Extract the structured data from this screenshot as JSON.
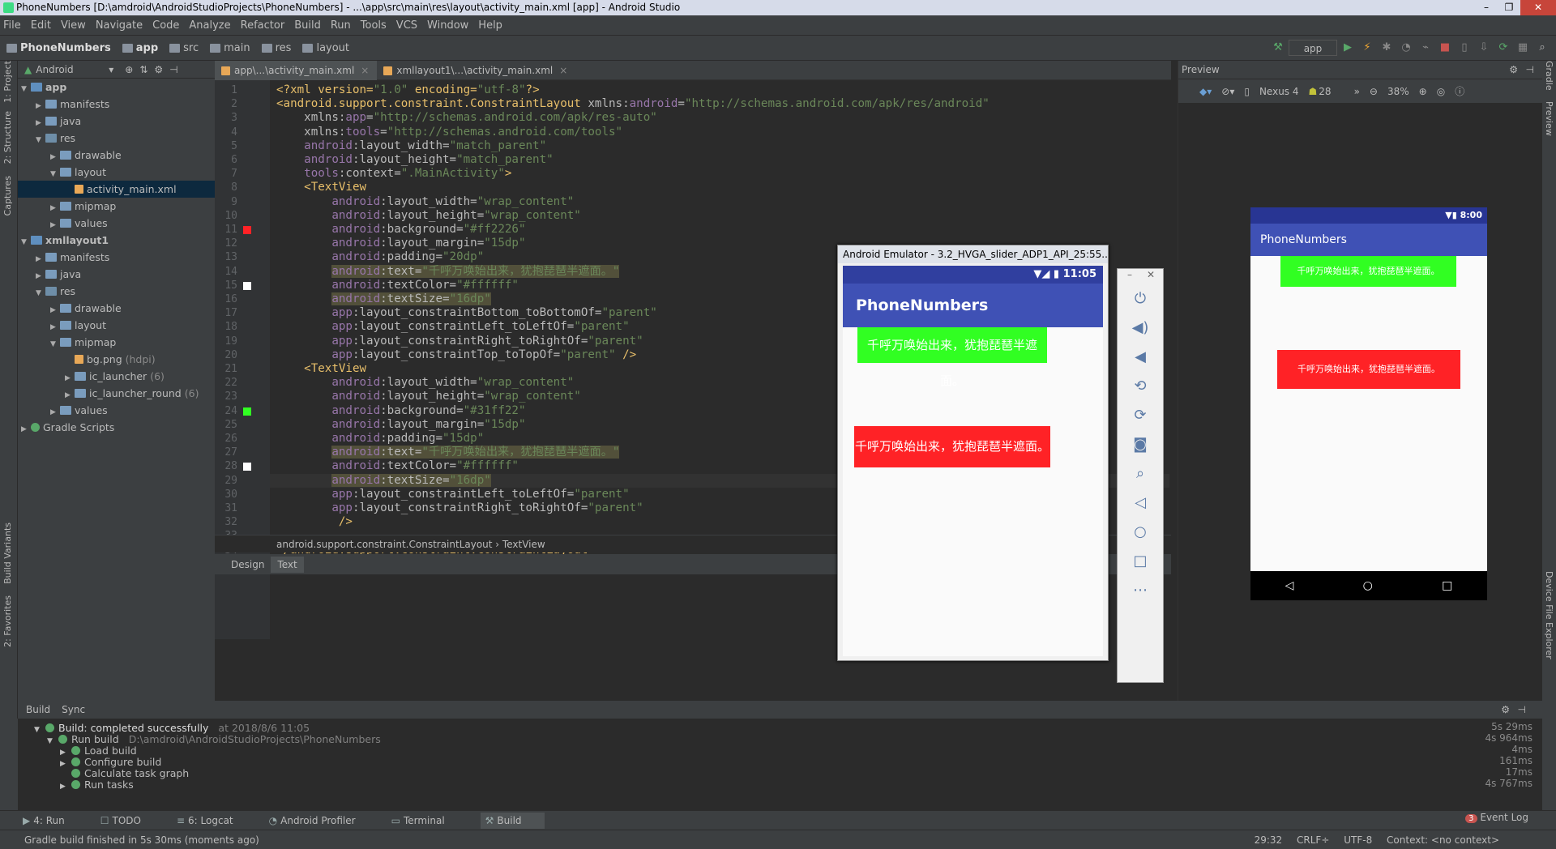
{
  "window": {
    "title": "PhoneNumbers [D:\\amdroid\\AndroidStudioProjects\\PhoneNumbers] - ...\\app\\src\\main\\res\\layout\\activity_main.xml [app] - Android Studio"
  },
  "menu": [
    "File",
    "Edit",
    "View",
    "Navigate",
    "Code",
    "Analyze",
    "Refactor",
    "Build",
    "Run",
    "Tools",
    "VCS",
    "Window",
    "Help"
  ],
  "breadcrumb": [
    "PhoneNumbers",
    "app",
    "src",
    "main",
    "res",
    "layout"
  ],
  "toolbar": {
    "config": "app"
  },
  "left_tabs": [
    "1: Project",
    "2: Structure",
    "Captures",
    "Build Variants",
    "2: Favorites"
  ],
  "project": {
    "view": "Android",
    "tree": [
      {
        "label": "app",
        "indent": 0,
        "arrow": "▼",
        "icon": "mod",
        "bold": true
      },
      {
        "label": "manifests",
        "indent": 1,
        "arrow": "▶",
        "icon": "fold"
      },
      {
        "label": "java",
        "indent": 1,
        "arrow": "▶",
        "icon": "fold"
      },
      {
        "label": "res",
        "indent": 1,
        "arrow": "▼",
        "icon": "res"
      },
      {
        "label": "drawable",
        "indent": 2,
        "arrow": "▶",
        "icon": "fold"
      },
      {
        "label": "layout",
        "indent": 2,
        "arrow": "▼",
        "icon": "fold"
      },
      {
        "label": "activity_main.xml",
        "indent": 3,
        "arrow": "",
        "icon": "file",
        "selected": true
      },
      {
        "label": "mipmap",
        "indent": 2,
        "arrow": "▶",
        "icon": "fold"
      },
      {
        "label": "values",
        "indent": 2,
        "arrow": "▶",
        "icon": "fold"
      },
      {
        "label": "xmllayout1",
        "indent": 0,
        "arrow": "▼",
        "icon": "mod",
        "bold": true
      },
      {
        "label": "manifests",
        "indent": 1,
        "arrow": "▶",
        "icon": "fold"
      },
      {
        "label": "java",
        "indent": 1,
        "arrow": "▶",
        "icon": "fold"
      },
      {
        "label": "res",
        "indent": 1,
        "arrow": "▼",
        "icon": "res"
      },
      {
        "label": "drawable",
        "indent": 2,
        "arrow": "▶",
        "icon": "fold"
      },
      {
        "label": "layout",
        "indent": 2,
        "arrow": "▶",
        "icon": "fold"
      },
      {
        "label": "mipmap",
        "indent": 2,
        "arrow": "▼",
        "icon": "fold"
      },
      {
        "label": "bg.png",
        "count": "(hdpi)",
        "indent": 3,
        "arrow": "",
        "icon": "file"
      },
      {
        "label": "ic_launcher",
        "count": "(6)",
        "indent": 3,
        "arrow": "▶",
        "icon": "fold"
      },
      {
        "label": "ic_launcher_round",
        "count": "(6)",
        "indent": 3,
        "arrow": "▶",
        "icon": "fold"
      },
      {
        "label": "values",
        "indent": 2,
        "arrow": "▶",
        "icon": "fold"
      },
      {
        "label": "Gradle Scripts",
        "indent": 0,
        "arrow": "▶",
        "icon": "grad"
      }
    ]
  },
  "editor": {
    "tabs": [
      {
        "label": "app\\...\\activity_main.xml",
        "active": true
      },
      {
        "label": "xmllayout1\\...\\activity_main.xml",
        "active": false
      }
    ],
    "gutter_colors": {
      "11": "#ff2226",
      "15": "#ffffff",
      "24": "#31ff22",
      "28": "#ffffff"
    },
    "current_line": 29,
    "lines": [
      [
        [
          "pi",
          "<?xml version="
        ],
        [
          "sv",
          "\"1.0\""
        ],
        [
          "pi",
          " encoding="
        ],
        [
          "sv",
          "\"utf-8\""
        ],
        [
          "pi",
          "?>"
        ]
      ],
      [
        [
          "tg",
          "<android.support.constraint.ConstraintLayout "
        ],
        [
          "at",
          "xmlns:"
        ],
        [
          "ns",
          "android"
        ],
        [
          "at",
          "="
        ],
        [
          "sv",
          "\"http://schemas.android.com/apk/res/android\""
        ]
      ],
      [
        [
          "at",
          "    xmlns:"
        ],
        [
          "ns",
          "app"
        ],
        [
          "at",
          "="
        ],
        [
          "sv",
          "\"http://schemas.android.com/apk/res-auto\""
        ]
      ],
      [
        [
          "at",
          "    xmlns:"
        ],
        [
          "ns",
          "tools"
        ],
        [
          "at",
          "="
        ],
        [
          "sv",
          "\"http://schemas.android.com/tools\""
        ]
      ],
      [
        [
          "ns",
          "    android"
        ],
        [
          "at",
          ":layout_width="
        ],
        [
          "sv",
          "\"match_parent\""
        ]
      ],
      [
        [
          "ns",
          "    android"
        ],
        [
          "at",
          ":layout_height="
        ],
        [
          "sv",
          "\"match_parent\""
        ]
      ],
      [
        [
          "ns",
          "    tools"
        ],
        [
          "at",
          ":context="
        ],
        [
          "sv",
          "\".MainActivity\""
        ],
        [
          "tg",
          ">"
        ]
      ],
      [
        [
          "tg",
          "    <TextView"
        ]
      ],
      [
        [
          "ns",
          "        android"
        ],
        [
          "at",
          ":layout_width="
        ],
        [
          "sv",
          "\"wrap_content\""
        ]
      ],
      [
        [
          "ns",
          "        android"
        ],
        [
          "at",
          ":layout_height="
        ],
        [
          "sv",
          "\"wrap_content\""
        ]
      ],
      [
        [
          "ns",
          "        android"
        ],
        [
          "at",
          ":background="
        ],
        [
          "sv",
          "\"#ff2226\""
        ]
      ],
      [
        [
          "ns",
          "        android"
        ],
        [
          "at",
          ":layout_margin="
        ],
        [
          "sv",
          "\"15dp\""
        ]
      ],
      [
        [
          "ns",
          "        android"
        ],
        [
          "at",
          ":padding="
        ],
        [
          "sv",
          "\"20dp\""
        ]
      ],
      [
        [
          "ns",
          "        "
        ],
        [
          "ns hl",
          "android"
        ],
        [
          "at hl",
          ":text="
        ],
        [
          "sv hl",
          "\"千呼万唤始出来，犹抱琵琶半遮面。\""
        ]
      ],
      [
        [
          "ns",
          "        android"
        ],
        [
          "at",
          ":textColor="
        ],
        [
          "sv",
          "\"#ffffff\""
        ]
      ],
      [
        [
          "ns",
          "        "
        ],
        [
          "ns hl",
          "android"
        ],
        [
          "at hl",
          ":textSize="
        ],
        [
          "sv hl",
          "\"16dp\""
        ]
      ],
      [
        [
          "ns",
          "        app"
        ],
        [
          "at",
          ":layout_constraintBottom_toBottomOf="
        ],
        [
          "sv",
          "\"parent\""
        ]
      ],
      [
        [
          "ns",
          "        app"
        ],
        [
          "at",
          ":layout_constraintLeft_toLeftOf="
        ],
        [
          "sv",
          "\"parent\""
        ]
      ],
      [
        [
          "ns",
          "        app"
        ],
        [
          "at",
          ":layout_constraintRight_toRightOf="
        ],
        [
          "sv",
          "\"parent\""
        ]
      ],
      [
        [
          "ns",
          "        app"
        ],
        [
          "at",
          ":layout_constraintTop_toTopOf="
        ],
        [
          "sv",
          "\"parent\""
        ],
        [
          "tg",
          " />"
        ]
      ],
      [
        [
          "tg",
          "    <TextView"
        ]
      ],
      [
        [
          "ns",
          "        android"
        ],
        [
          "at",
          ":layout_width="
        ],
        [
          "sv",
          "\"wrap_content\""
        ]
      ],
      [
        [
          "ns",
          "        android"
        ],
        [
          "at",
          ":layout_height="
        ],
        [
          "sv",
          "\"wrap_content\""
        ]
      ],
      [
        [
          "ns",
          "        android"
        ],
        [
          "at",
          ":background="
        ],
        [
          "sv",
          "\"#31ff22\""
        ]
      ],
      [
        [
          "ns",
          "        android"
        ],
        [
          "at",
          ":layout_margin="
        ],
        [
          "sv",
          "\"15dp\""
        ]
      ],
      [
        [
          "ns",
          "        android"
        ],
        [
          "at",
          ":padding="
        ],
        [
          "sv",
          "\"15dp\""
        ]
      ],
      [
        [
          "ns",
          "        "
        ],
        [
          "ns hl",
          "android"
        ],
        [
          "at hl",
          ":text="
        ],
        [
          "sv hl",
          "\"千呼万唤始出来，犹抱琵琶半遮面。\""
        ]
      ],
      [
        [
          "ns",
          "        android"
        ],
        [
          "at",
          ":textColor="
        ],
        [
          "sv",
          "\"#ffffff\""
        ]
      ],
      [
        [
          "ns",
          "        "
        ],
        [
          "ns hl",
          "android"
        ],
        [
          "at hl",
          ":textSize="
        ],
        [
          "sv hl",
          "\"16dp\""
        ]
      ],
      [
        [
          "ns",
          "        app"
        ],
        [
          "at",
          ":layout_constraintLeft_toLeftOf="
        ],
        [
          "sv",
          "\"parent\""
        ]
      ],
      [
        [
          "ns",
          "        app"
        ],
        [
          "at",
          ":layout_constraintRight_toRightOf="
        ],
        [
          "sv",
          "\"parent\""
        ]
      ],
      [
        [
          "tg",
          "         />"
        ]
      ],
      [
        [
          "at",
          ""
        ]
      ],
      [
        [
          "tg",
          "</android.support.constraint.ConstraintLayout>"
        ]
      ]
    ],
    "crumbs": "android.support.constraint.ConstraintLayout  ›  TextView",
    "design_tab": "Design",
    "text_tab": "Text"
  },
  "preview": {
    "title": "Preview",
    "device": "Nexus 4",
    "api": "28",
    "zoom": "38%",
    "time": "8:00",
    "app_title": "PhoneNumbers",
    "text": "千呼万唤始出来，犹抱琵琶半遮面。",
    "green": "#31ff22",
    "red": "#ff2226"
  },
  "emulator": {
    "title": "Android Emulator - 3.2_HVGA_slider_ADP1_API_25:55...",
    "time": "11:05",
    "app_title": "PhoneNumbers",
    "text": "千呼万唤始出来，犹抱琵琶半遮面。",
    "controls": [
      "power-icon",
      "volume-up-icon",
      "volume-down-icon",
      "rotate-left-icon",
      "rotate-right-icon",
      "camera-icon",
      "zoom-icon",
      "back-icon",
      "home-icon",
      "overview-icon",
      "more-icon"
    ]
  },
  "build": {
    "tabs": [
      "Build",
      "Sync"
    ],
    "rows": [
      {
        "label": "Build: completed successfully",
        "extra": "at 2018/8/6 11:05",
        "indent": 0,
        "time": "5s 29ms",
        "arrow": "▼"
      },
      {
        "label": "Run build",
        "extra": "D:\\amdroid\\AndroidStudioProjects\\PhoneNumbers",
        "indent": 1,
        "time": "4s 964ms",
        "arrow": "▼"
      },
      {
        "label": "Load build",
        "extra": "",
        "indent": 2,
        "time": "4ms",
        "arrow": "▶"
      },
      {
        "label": "Configure build",
        "extra": "",
        "indent": 2,
        "time": "161ms",
        "arrow": "▶"
      },
      {
        "label": "Calculate task graph",
        "extra": "",
        "indent": 2,
        "time": "17ms",
        "arrow": ""
      },
      {
        "label": "Run tasks",
        "extra": "",
        "indent": 2,
        "time": "4s 767ms",
        "arrow": "▶"
      }
    ]
  },
  "bottom_tabs": [
    "4: Run",
    "TODO",
    "6: Logcat",
    "Android Profiler",
    "Terminal",
    "Build"
  ],
  "status": {
    "message": "Gradle build finished in 5s 30ms (moments ago)",
    "position": "29:32",
    "line_sep": "CRLF÷",
    "encoding": "UTF-8",
    "context": "Context: <no context>",
    "event_log": "Event Log",
    "event_count": "3"
  },
  "right_tabs": [
    "Gradle",
    "Preview",
    "Device File Explorer"
  ]
}
